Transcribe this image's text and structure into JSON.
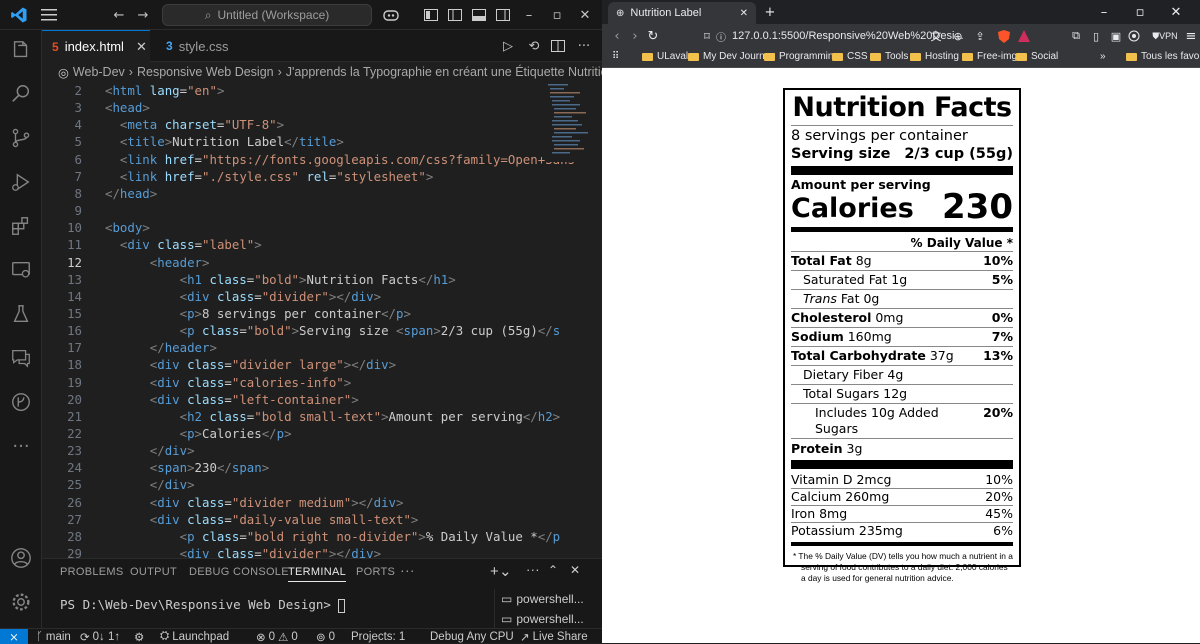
{
  "vscode": {
    "command_center": "Untitled (Workspace)",
    "tabs": [
      {
        "label": "index.html",
        "icon": "html-file-icon",
        "active": true
      },
      {
        "label": "style.css",
        "icon": "css-file-icon",
        "active": false
      }
    ],
    "breadcrumb": [
      "Web-Dev",
      "Responsive Web Design",
      "J'apprends la Typographie en créant une Étiquette Nutritionnelle"
    ],
    "current_line": 12,
    "code_lines": [
      {
        "n": "2",
        "html": "<span class='t-br'>&lt;</span><span class='t-tag'>html</span> <span class='t-attr'>lang</span>=<span class='t-str'>\"en\"</span><span class='t-br'>&gt;</span>"
      },
      {
        "n": "3",
        "html": "<span class='t-br'>&lt;</span><span class='t-tag'>head</span><span class='t-br'>&gt;</span>"
      },
      {
        "n": "4",
        "html": "  <span class='t-br'>&lt;</span><span class='t-tag'>meta</span> <span class='t-attr'>charset</span>=<span class='t-str'>\"UTF-8\"</span><span class='t-br'>&gt;</span>"
      },
      {
        "n": "5",
        "html": "  <span class='t-br'>&lt;</span><span class='t-tag'>title</span><span class='t-br'>&gt;</span>Nutrition Label<span class='t-br'>&lt;/</span><span class='t-tag'>title</span><span class='t-br'>&gt;</span>"
      },
      {
        "n": "6",
        "html": "  <span class='t-br'>&lt;</span><span class='t-tag'>link</span> <span class='t-attr'>href</span>=<span class='t-str'>\"https://fonts.googleapis.com/css?family=Open+Sans</span>"
      },
      {
        "n": "7",
        "html": "  <span class='t-br'>&lt;</span><span class='t-tag'>link</span> <span class='t-attr'>href</span>=<span class='t-str'>\"./style.css\"</span> <span class='t-attr'>rel</span>=<span class='t-str'>\"stylesheet\"</span><span class='t-br'>&gt;</span>"
      },
      {
        "n": "8",
        "html": "<span class='t-br'>&lt;/</span><span class='t-tag'>head</span><span class='t-br'>&gt;</span>"
      },
      {
        "n": "9",
        "html": ""
      },
      {
        "n": "10",
        "html": "<span class='t-br'>&lt;</span><span class='t-tag'>body</span><span class='t-br'>&gt;</span>"
      },
      {
        "n": "11",
        "html": "  <span class='t-br'>&lt;</span><span class='t-tag'>div</span> <span class='t-attr'>class</span>=<span class='t-str'>\"label\"</span><span class='t-br'>&gt;</span>"
      },
      {
        "n": "12",
        "html": "      <span class='t-br'>&lt;</span><span class='t-tag'>header</span><span class='t-br'>&gt;</span>"
      },
      {
        "n": "13",
        "html": "          <span class='t-br'>&lt;</span><span class='t-tag'>h1</span> <span class='t-attr'>class</span>=<span class='t-str'>\"bold\"</span><span class='t-br'>&gt;</span>Nutrition Facts<span class='t-br'>&lt;/</span><span class='t-tag'>h1</span><span class='t-br'>&gt;</span>"
      },
      {
        "n": "14",
        "html": "          <span class='t-br'>&lt;</span><span class='t-tag'>div</span> <span class='t-attr'>class</span>=<span class='t-str'>\"divider\"</span><span class='t-br'>&gt;&lt;/</span><span class='t-tag'>div</span><span class='t-br'>&gt;</span>"
      },
      {
        "n": "15",
        "html": "          <span class='t-br'>&lt;</span><span class='t-tag'>p</span><span class='t-br'>&gt;</span>8 servings per container<span class='t-br'>&lt;/</span><span class='t-tag'>p</span><span class='t-br'>&gt;</span>"
      },
      {
        "n": "16",
        "html": "          <span class='t-br'>&lt;</span><span class='t-tag'>p</span> <span class='t-attr'>class</span>=<span class='t-str'>\"bold\"</span><span class='t-br'>&gt;</span>Serving size <span class='t-br'>&lt;</span><span class='t-tag'>span</span><span class='t-br'>&gt;</span>2/3 cup (55g)<span class='t-br'>&lt;/</span><span class='t-tag'>s</span>"
      },
      {
        "n": "17",
        "html": "      <span class='t-br'>&lt;/</span><span class='t-tag'>header</span><span class='t-br'>&gt;</span>"
      },
      {
        "n": "18",
        "html": "      <span class='t-br'>&lt;</span><span class='t-tag'>div</span> <span class='t-attr'>class</span>=<span class='t-str'>\"divider large\"</span><span class='t-br'>&gt;&lt;/</span><span class='t-tag'>div</span><span class='t-br'>&gt;</span>"
      },
      {
        "n": "19",
        "html": "      <span class='t-br'>&lt;</span><span class='t-tag'>div</span> <span class='t-attr'>class</span>=<span class='t-str'>\"calories-info\"</span><span class='t-br'>&gt;</span>"
      },
      {
        "n": "20",
        "html": "      <span class='t-br'>&lt;</span><span class='t-tag'>div</span> <span class='t-attr'>class</span>=<span class='t-str'>\"left-container\"</span><span class='t-br'>&gt;</span>"
      },
      {
        "n": "21",
        "html": "          <span class='t-br'>&lt;</span><span class='t-tag'>h2</span> <span class='t-attr'>class</span>=<span class='t-str'>\"bold small-text\"</span><span class='t-br'>&gt;</span>Amount per serving<span class='t-br'>&lt;/</span><span class='t-tag'>h2</span><span class='t-br'>&gt;</span>"
      },
      {
        "n": "22",
        "html": "          <span class='t-br'>&lt;</span><span class='t-tag'>p</span><span class='t-br'>&gt;</span>Calories<span class='t-br'>&lt;/</span><span class='t-tag'>p</span><span class='t-br'>&gt;</span>"
      },
      {
        "n": "23",
        "html": "      <span class='t-br'>&lt;/</span><span class='t-tag'>div</span><span class='t-br'>&gt;</span>"
      },
      {
        "n": "24",
        "html": "      <span class='t-br'>&lt;</span><span class='t-tag'>span</span><span class='t-br'>&gt;</span>230<span class='t-br'>&lt;/</span><span class='t-tag'>span</span><span class='t-br'>&gt;</span>"
      },
      {
        "n": "25",
        "html": "      <span class='t-br'>&lt;/</span><span class='t-tag'>div</span><span class='t-br'>&gt;</span>"
      },
      {
        "n": "26",
        "html": "      <span class='t-br'>&lt;</span><span class='t-tag'>div</span> <span class='t-attr'>class</span>=<span class='t-str'>\"divider medium\"</span><span class='t-br'>&gt;&lt;/</span><span class='t-tag'>div</span><span class='t-br'>&gt;</span>"
      },
      {
        "n": "27",
        "html": "      <span class='t-br'>&lt;</span><span class='t-tag'>div</span> <span class='t-attr'>class</span>=<span class='t-str'>\"daily-value small-text\"</span><span class='t-br'>&gt;</span>"
      },
      {
        "n": "28",
        "html": "          <span class='t-br'>&lt;</span><span class='t-tag'>p</span> <span class='t-attr'>class</span>=<span class='t-str'>\"bold right no-divider\"</span><span class='t-br'>&gt;</span>% Daily Value *<span class='t-br'>&lt;/</span><span class='t-tag'>p</span>"
      },
      {
        "n": "29",
        "html": "          <span class='t-br'>&lt;</span><span class='t-tag'>div</span> <span class='t-attr'>class</span>=<span class='t-str'>\"divider\"</span><span class='t-br'>&gt;&lt;/</span><span class='t-tag'>div</span><span class='t-br'>&gt;</span>"
      }
    ],
    "panel_tabs": [
      "PROBLEMS",
      "OUTPUT",
      "DEBUG CONSOLE",
      "TERMINAL",
      "PORTS"
    ],
    "active_panel_tab": "TERMINAL",
    "terminal_prompt": "PS D:\\Web-Dev\\Responsive Web Design> ",
    "terminal_instances": [
      "powershell...",
      "powershell..."
    ],
    "status": {
      "branch": "main",
      "sync": "0↓ 1↑",
      "launchpad": "Launchpad",
      "errors": "0",
      "warnings": "0",
      "ports": "0",
      "projects": "Projects: 1",
      "cpu": "Debug Any CPU",
      "live": "Live Share"
    },
    "colors": {
      "accent": "#0078d4",
      "tag": "#569cd6",
      "attr": "#9cdcfe",
      "string": "#ce9178"
    }
  },
  "browser": {
    "tab_title": "Nutrition Label",
    "url": "127.0.0.1:5500/Responsive%20Web%20Desi...",
    "vpn": "VPN",
    "bookmarks": [
      "ULaval",
      "My Dev Journey",
      "Programming",
      "CSS",
      "Tools",
      "Hosting",
      "Free-img",
      "Social"
    ],
    "all_bookmarks": "Tous les favoris"
  },
  "label": {
    "title": "Nutrition Facts",
    "servings": "8 servings per container",
    "serving_size_label": "Serving size",
    "serving_size_value": "2/3 cup (55g)",
    "amount_per_serving": "Amount per serving",
    "calories_label": "Calories",
    "calories_value": "230",
    "daily_value_header": "% Daily Value *",
    "nutrients": [
      {
        "name": "Total Fat",
        "amount": "8g",
        "dv": "10%",
        "bold": true,
        "indent": 0
      },
      {
        "name": "Saturated Fat",
        "amount": "1g",
        "dv": "5%",
        "bold": false,
        "indent": 1
      },
      {
        "name": "Trans",
        "amount": "Fat 0g",
        "dv": "",
        "bold": false,
        "indent": 1,
        "italic": true
      },
      {
        "name": "Cholesterol",
        "amount": "0mg",
        "dv": "0%",
        "bold": true,
        "indent": 0
      },
      {
        "name": "Sodium",
        "amount": "160mg",
        "dv": "7%",
        "bold": true,
        "indent": 0
      },
      {
        "name": "Total Carbohydrate",
        "amount": "37g",
        "dv": "13%",
        "bold": true,
        "indent": 0
      },
      {
        "name": "Dietary Fiber",
        "amount": "4g",
        "dv": "",
        "bold": false,
        "indent": 1
      },
      {
        "name": "Total Sugars",
        "amount": "12g",
        "dv": "",
        "bold": false,
        "indent": 1
      },
      {
        "name": "Includes 10g Added Sugars",
        "amount": "",
        "dv": "20%",
        "bold": false,
        "indent": 2
      },
      {
        "name": "Protein",
        "amount": "3g",
        "dv": "",
        "bold": true,
        "indent": 0
      }
    ],
    "vitamins": [
      {
        "name": "Vitamin D 2mcg",
        "dv": "10%"
      },
      {
        "name": "Calcium 260mg",
        "dv": "20%"
      },
      {
        "name": "Iron 8mg",
        "dv": "45%"
      },
      {
        "name": "Potassium 235mg",
        "dv": "6%"
      }
    ],
    "note": "* The % Daily Value (DV) tells you how much a nutrient in a serving of food contributes to a daily diet. 2,000 calories a day is used for general nutrition advice."
  }
}
